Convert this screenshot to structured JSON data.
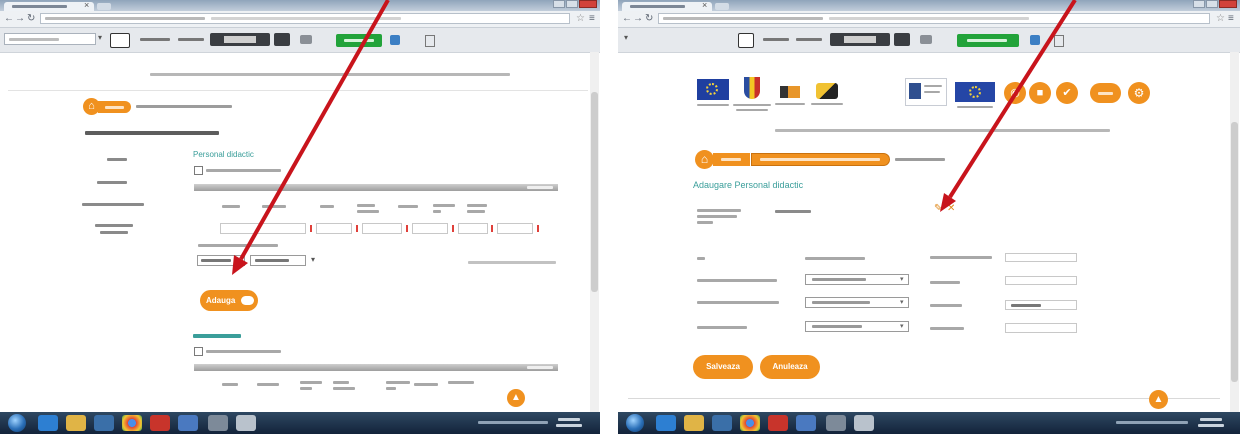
{
  "left_screen": {
    "section_title": "Personal didactic",
    "add_button": "Adauga"
  },
  "right_screen": {
    "form_title": "Adaugare Personal didactic",
    "save_button": "Salveaza",
    "cancel_button": "Anuleaza"
  },
  "icons": {
    "breadcrumb_home": "house-icon",
    "scroll_top": "arrow-up-icon",
    "edit": "pencil-icon",
    "remove": "close-icon",
    "annotation": "red-arrow"
  },
  "colors": {
    "accent_orange": "#f0911f",
    "heading_teal": "#3a9e9a",
    "annotation_arrow": "#c8141c",
    "toolbar_button_green": "#22a33a",
    "taskbar": "#1b3047"
  }
}
